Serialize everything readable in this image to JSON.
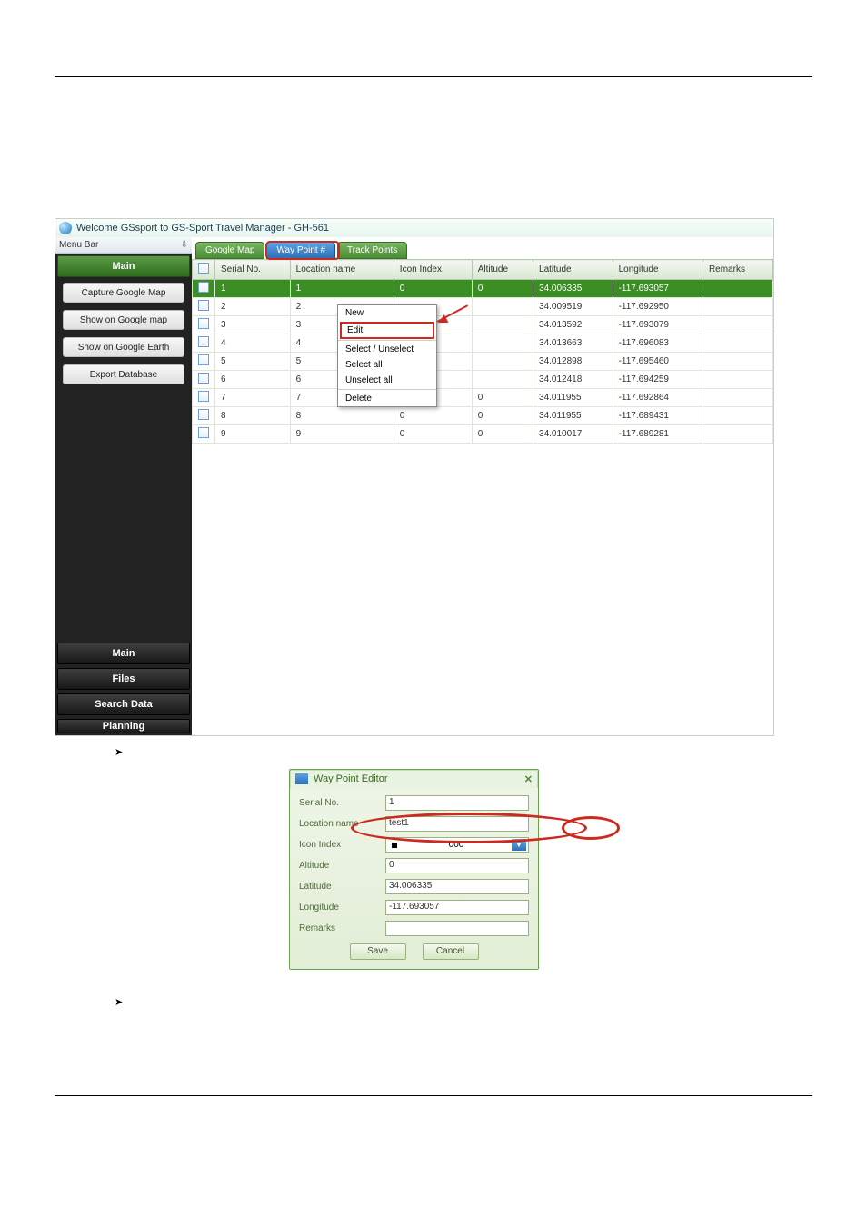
{
  "app": {
    "title": "Welcome GSsport to GS-Sport Travel Manager - GH-561",
    "menubar_label": "Menu Bar"
  },
  "sidebar": {
    "main_title": "Main",
    "items": [
      "Capture Google Map",
      "Show on Google map",
      "Show on Google Earth",
      "Export Database"
    ],
    "bottom": [
      "Main",
      "Files",
      "Search Data",
      "Planning"
    ]
  },
  "tabs": {
    "google_map": "Google Map",
    "way_point": "Way Point #",
    "track_points": "Track Points"
  },
  "columns": {
    "sel": "",
    "serial": "Serial No.",
    "location": "Location name",
    "icon": "Icon Index",
    "altitude": "Altitude",
    "latitude": "Latitude",
    "longitude": "Longitude",
    "remarks": "Remarks"
  },
  "rows": [
    {
      "serial": "1",
      "location": "1",
      "icon": "0",
      "altitude": "0",
      "lat": "34.006335",
      "lon": "-117.693057",
      "remarks": ""
    },
    {
      "serial": "2",
      "location": "2",
      "icon": "",
      "altitude": "",
      "lat": "34.009519",
      "lon": "-117.692950",
      "remarks": ""
    },
    {
      "serial": "3",
      "location": "3",
      "icon": "",
      "altitude": "",
      "lat": "34.013592",
      "lon": "-117.693079",
      "remarks": ""
    },
    {
      "serial": "4",
      "location": "4",
      "icon": "",
      "altitude": "",
      "lat": "34.013663",
      "lon": "-117.696083",
      "remarks": ""
    },
    {
      "serial": "5",
      "location": "5",
      "icon": "",
      "altitude": "",
      "lat": "34.012898",
      "lon": "-117.695460",
      "remarks": ""
    },
    {
      "serial": "6",
      "location": "6",
      "icon": "",
      "altitude": "",
      "lat": "34.012418",
      "lon": "-117.694259",
      "remarks": ""
    },
    {
      "serial": "7",
      "location": "7",
      "icon": "0",
      "altitude": "0",
      "lat": "34.011955",
      "lon": "-117.692864",
      "remarks": ""
    },
    {
      "serial": "8",
      "location": "8",
      "icon": "0",
      "altitude": "0",
      "lat": "34.011955",
      "lon": "-117.689431",
      "remarks": ""
    },
    {
      "serial": "9",
      "location": "9",
      "icon": "0",
      "altitude": "0",
      "lat": "34.010017",
      "lon": "-117.689281",
      "remarks": ""
    }
  ],
  "context_menu": {
    "new": "New",
    "edit": "Edit",
    "select_unselect": "Select / Unselect",
    "select_all": "Select all",
    "unselect_all": "Unselect all",
    "delete": "Delete"
  },
  "bullet1": "",
  "bullet2": "",
  "editor": {
    "title": "Way Point Editor",
    "labels": {
      "serial": "Serial No.",
      "location": "Location name",
      "icon": "Icon Index",
      "altitude": "Altitude",
      "latitude": "Latitude",
      "longitude": "Longitude",
      "remarks": "Remarks"
    },
    "values": {
      "serial": "1",
      "location": "test1",
      "icon": "000",
      "altitude": "0",
      "latitude": "34.006335",
      "longitude": "-117.693057",
      "remarks": ""
    },
    "save": "Save",
    "cancel": "Cancel"
  }
}
